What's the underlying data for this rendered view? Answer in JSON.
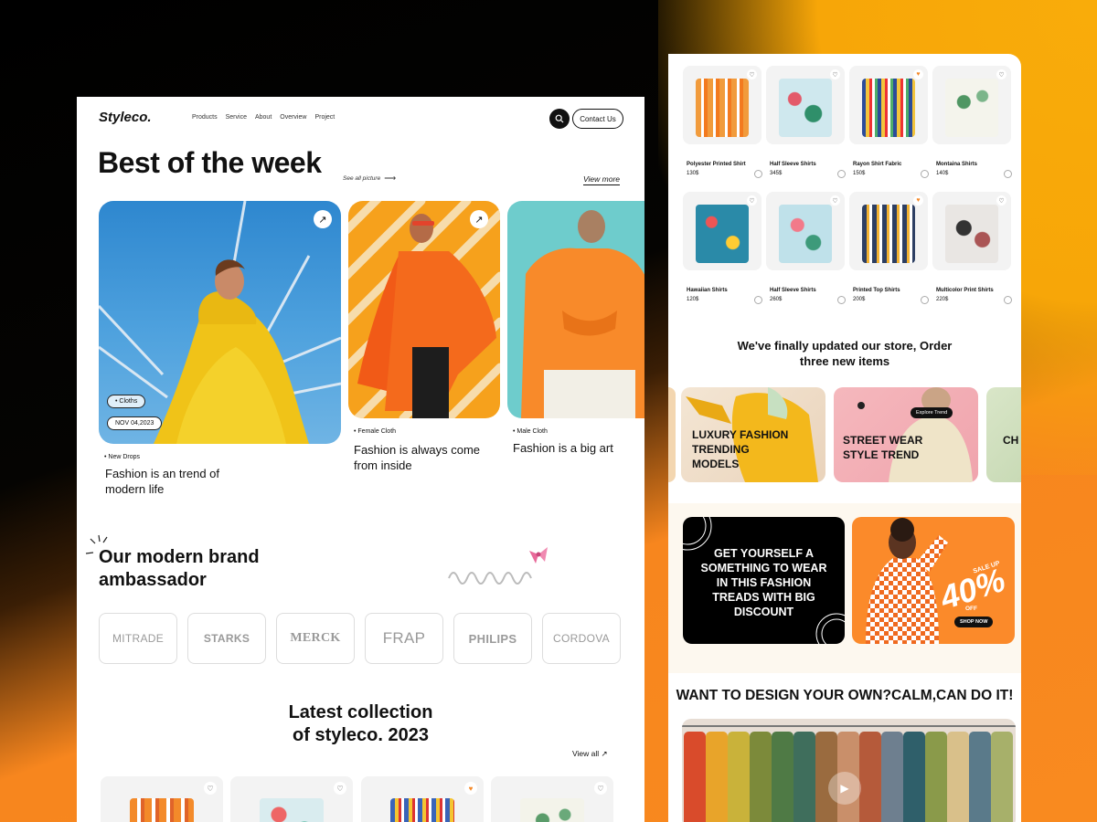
{
  "left": {
    "logo": "Styleco.",
    "nav": [
      "Products",
      "Service",
      "About",
      "Overview",
      "Project"
    ],
    "contact_label": "Contact Us",
    "hero_title": "Best of the week",
    "see_all": "See all picture",
    "view_more": "View more",
    "cards": [
      {
        "badge": "Cloths",
        "date": "NOV 04,2023",
        "tag": "New Drops",
        "title_1": "Fashion is an trend of",
        "title_2": "modern life"
      },
      {
        "tag": "Female Cloth",
        "title_1": "Fashion is always come",
        "title_2": "from inside"
      },
      {
        "tag": "Male Cloth",
        "title_1": "Fashion is a big art"
      }
    ],
    "ambassador_1": "Our modern brand",
    "ambassador_2": "ambassador",
    "brands": [
      "MITRADE",
      "STARKS",
      "MERCK",
      "FRAP",
      "PHILIPS",
      "CORDOVA"
    ],
    "latest_1": "Latest collection",
    "latest_2": "of styleco. 2023",
    "view_all": "View all"
  },
  "right": {
    "products": [
      {
        "name": "Polyester Printed Shirt",
        "price": "130$",
        "favorite": false
      },
      {
        "name": "Half Sleeve Shirts",
        "price": "345$",
        "favorite": false
      },
      {
        "name": "Rayon Shirt Fabric",
        "price": "150$",
        "favorite": true
      },
      {
        "name": "Montaina Shirts",
        "price": "140$",
        "favorite": false
      },
      {
        "name": "Hawaiian Shirts",
        "price": "120$",
        "favorite": false
      },
      {
        "name": "Half Sleeve Shirts",
        "price": "260$",
        "favorite": false
      },
      {
        "name": "Printed Top Shirts",
        "price": "200$",
        "favorite": true
      },
      {
        "name": "Multicolor Print Shirts",
        "price": "220$",
        "favorite": false
      }
    ],
    "update_1": "We've finally updated our store, Order",
    "update_2": "three new items",
    "categories": [
      {
        "line1": "LUXURY FASHION",
        "line2": "TRENDING",
        "line3": "MODELS"
      },
      {
        "line1": "STREET WEAR",
        "line2": "STYLE TREND",
        "button": "Explore Trend"
      },
      {
        "line1": "CH"
      }
    ],
    "promo_lines": [
      "GET YOURSELF A",
      "SOMETHING TO WEAR",
      "IN THIS FASHION",
      "TREADS WITH BIG",
      "DISCOUNT"
    ],
    "sale_up": "SALE UP",
    "sale_value": "40%",
    "sale_off": "OFF",
    "shop_now": "SHOP NOW",
    "design_title": "WANT TO DESIGN YOUR OWN?CALM,CAN DO IT!"
  },
  "colors": {
    "accent": "#fb8a2a",
    "yellow": "#f7a608",
    "dark": "#111111"
  }
}
